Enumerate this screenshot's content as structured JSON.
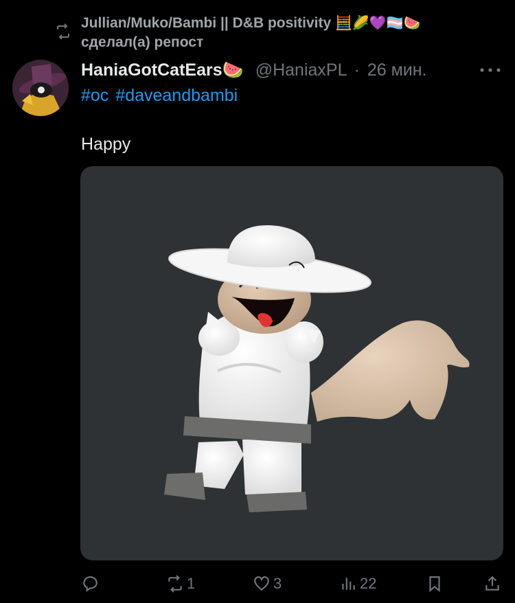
{
  "repost": {
    "reposter_name": "Jullian/Muko/Bambi || D&B positivity",
    "reposter_emojis": "🧮🌽💜🏳️‍⚧️🍉",
    "label": "сделал(а) репост"
  },
  "tweet": {
    "display_name": "HaniaGotCatEars",
    "name_emoji": "🍉",
    "handle": "@HaniaxPL",
    "separator": "·",
    "time": "26 мин.",
    "hashtags": [
      "#oc",
      "#daveandbambi"
    ],
    "text": "Happy",
    "media_alt": "3D character in white hat and outfit with tan tail, smiling"
  },
  "actions": {
    "reply_count": "",
    "repost_count": "1",
    "like_count": "3",
    "views_count": "22"
  },
  "colors": {
    "background": "#000000",
    "text": "#e7e9ea",
    "secondary": "#71767b",
    "link": "#1d9bf0",
    "media_bg": "#2f3234"
  }
}
